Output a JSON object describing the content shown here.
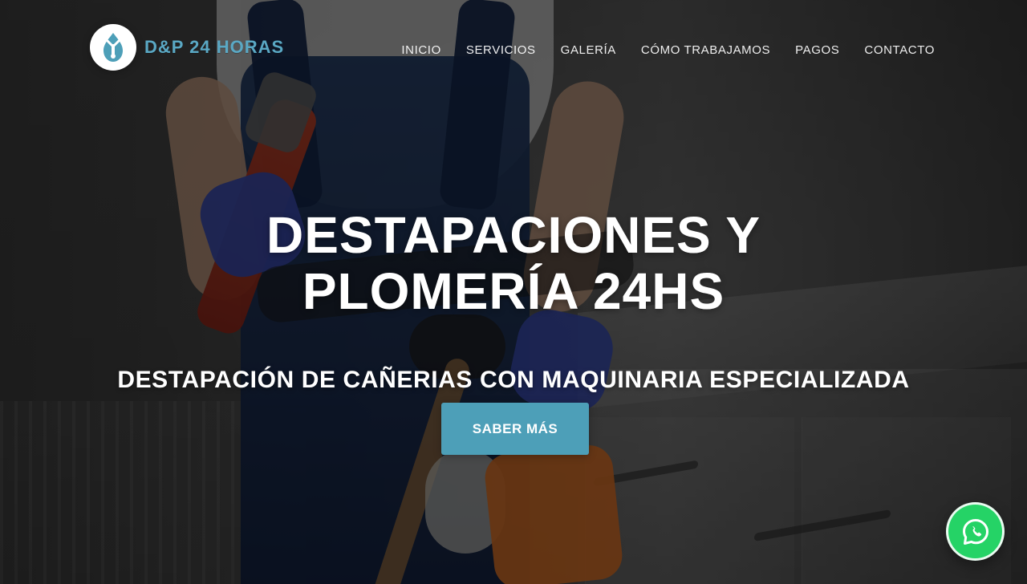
{
  "brand": {
    "name": "D&P 24 HORAS",
    "logo_icon": "wrench-drop-icon",
    "accent_color": "#5aa8c4"
  },
  "nav": {
    "items": [
      {
        "label": "INICIO"
      },
      {
        "label": "SERVICIOS"
      },
      {
        "label": "GALERÍA"
      },
      {
        "label": "CÓMO TRABAJAMOS"
      },
      {
        "label": "PAGOS"
      },
      {
        "label": "CONTACTO"
      }
    ]
  },
  "hero": {
    "headline_line1": "DESTAPACIONES Y",
    "headline_line2": "PLOMERÍA 24HS",
    "subheadline": "DESTAPACIÓN DE CAÑERIAS CON MAQUINARIA ESPECIALIZADA",
    "cta_label": "SABER MÁS",
    "cta_color": "#4d9fb8"
  },
  "floating": {
    "whatsapp_icon": "whatsapp-icon",
    "whatsapp_color": "#25d366"
  }
}
